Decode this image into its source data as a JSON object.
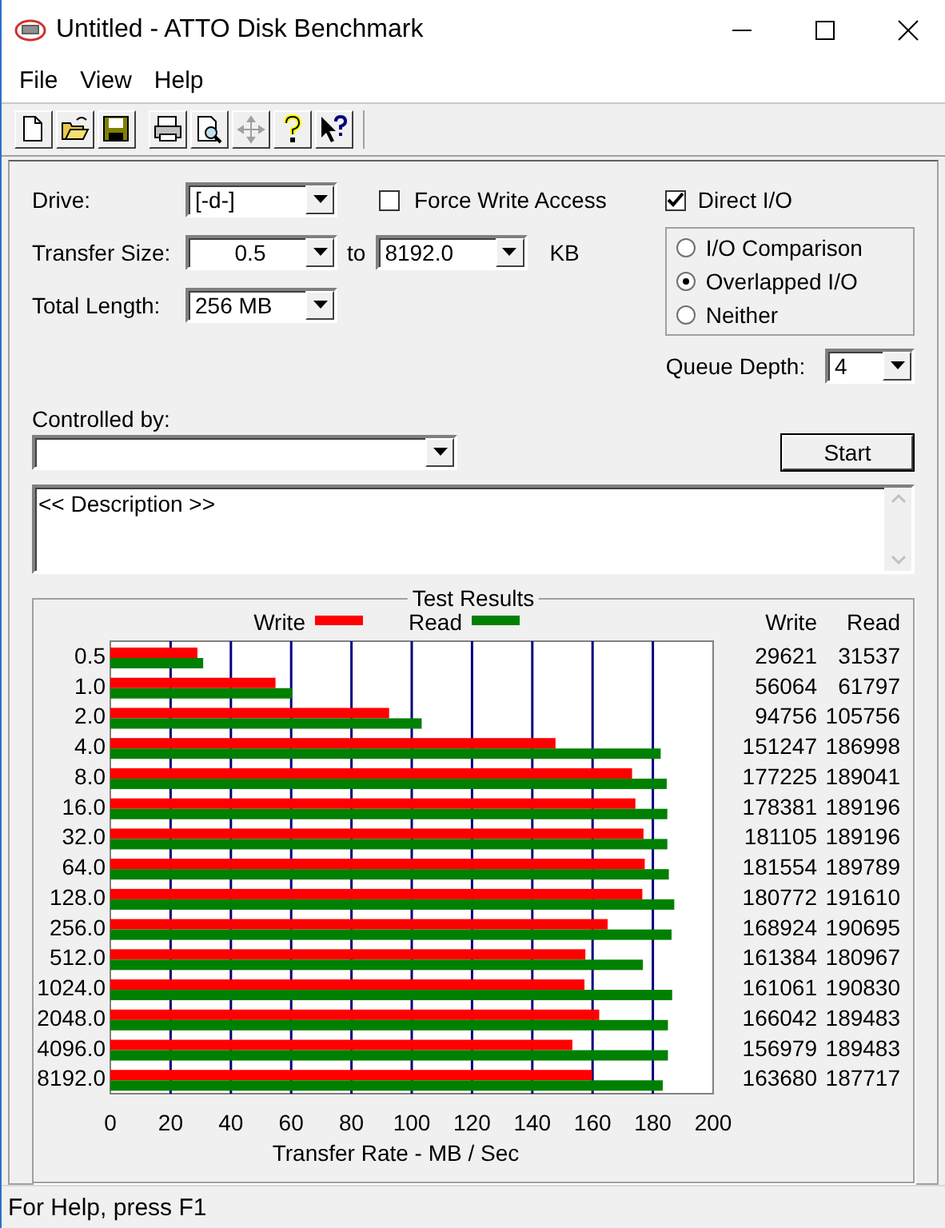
{
  "window": {
    "title": "Untitled - ATTO Disk Benchmark"
  },
  "menu": [
    "File",
    "View",
    "Help"
  ],
  "toolbar_buttons": [
    {
      "disabled": false
    },
    {
      "disabled": false
    },
    {
      "disabled": false
    },
    {
      "disabled": false
    },
    {
      "disabled": false
    },
    {
      "disabled": true
    },
    {
      "disabled": false
    },
    {
      "disabled": false
    }
  ],
  "drive": {
    "label": "Drive:",
    "value": "[-d-]"
  },
  "force_write_access": {
    "label": "Force Write Access",
    "checked": false
  },
  "direct_io": {
    "label": "Direct I/O",
    "checked": true
  },
  "transfer_size": {
    "label": "Transfer Size:",
    "from": "0.5",
    "to_label": "to",
    "to": "8192.0",
    "unit": "KB"
  },
  "total_length": {
    "label": "Total Length:",
    "value": "256 MB"
  },
  "io_mode": [
    {
      "label": "I/O Comparison",
      "selected": false
    },
    {
      "label": "Overlapped I/O",
      "selected": true
    },
    {
      "label": "Neither",
      "selected": false
    }
  ],
  "queue_depth": {
    "label": "Queue Depth:",
    "value": "4"
  },
  "controlled_by": {
    "label": "Controlled by:"
  },
  "start_button": "Start",
  "description": "<< Description >>",
  "test_results": {
    "title": "Test Results",
    "table": {
      "columns": [
        "Write",
        "Read"
      ],
      "rows": [
        [
          "29621",
          "31537"
        ],
        [
          "56064",
          "61797"
        ],
        [
          "94756",
          "105756"
        ],
        [
          "151247",
          "186998"
        ],
        [
          "177225",
          "189041"
        ],
        [
          "178381",
          "189196"
        ],
        [
          "181105",
          "189196"
        ],
        [
          "181554",
          "189789"
        ],
        [
          "180772",
          "191610"
        ],
        [
          "168924",
          "190695"
        ],
        [
          "161384",
          "180967"
        ],
        [
          "161061",
          "190830"
        ],
        [
          "166042",
          "189483"
        ],
        [
          "156979",
          "189483"
        ],
        [
          "163680",
          "187717"
        ]
      ]
    },
    "chart_data": {
      "type": "bar",
      "orientation": "horizontal",
      "grid": true,
      "legend": "top",
      "xlabel": "Transfer Rate - MB / Sec",
      "xlim": [
        0,
        200
      ],
      "xticks": [
        0,
        20,
        40,
        60,
        80,
        100,
        120,
        140,
        160,
        180,
        200
      ],
      "categories": [
        "0.5",
        "1.0",
        "2.0",
        "4.0",
        "8.0",
        "16.0",
        "32.0",
        "64.0",
        "128.0",
        "256.0",
        "512.0",
        "1024.0",
        "2048.0",
        "4096.0",
        "8192.0"
      ],
      "series": [
        {
          "name": "Write",
          "color": "#ff0000",
          "values": [
            28.9,
            54.8,
            92.5,
            147.7,
            173.1,
            174.2,
            176.9,
            177.3,
            176.5,
            165.0,
            157.6,
            157.3,
            162.2,
            153.3,
            159.8
          ]
        },
        {
          "name": "Read",
          "color": "#008000",
          "values": [
            30.8,
            60.3,
            103.3,
            182.6,
            184.6,
            184.8,
            184.8,
            185.3,
            187.1,
            186.2,
            176.7,
            186.4,
            185.0,
            185.0,
            183.3
          ]
        }
      ]
    }
  },
  "status_bar": "For Help, press F1"
}
